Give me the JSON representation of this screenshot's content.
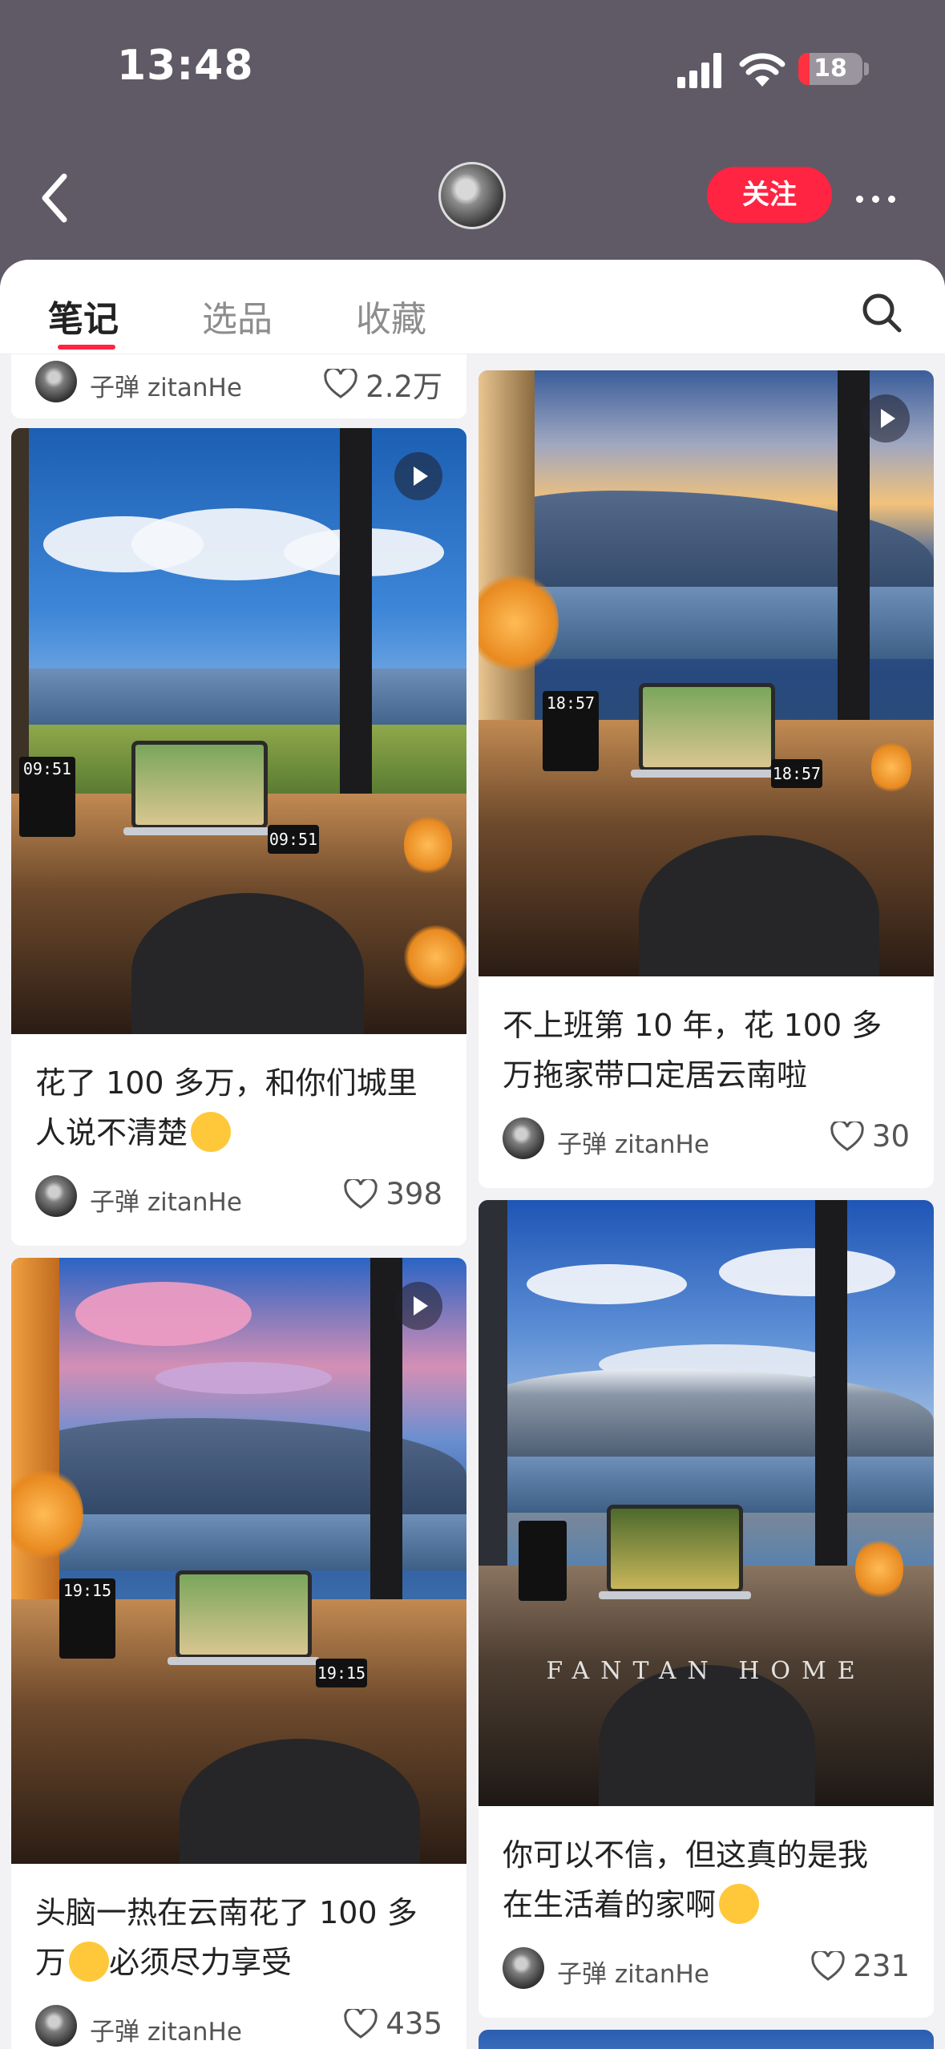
{
  "status_bar": {
    "time": "13:48",
    "battery": "18"
  },
  "header": {
    "follow_label": "关注"
  },
  "tabs": [
    {
      "label": "笔记",
      "active": true
    },
    {
      "label": "选品",
      "active": false
    },
    {
      "label": "收藏",
      "active": false
    }
  ],
  "feed": {
    "partial_top": {
      "author": "子弹 zitanHe",
      "likes": "2.2万"
    },
    "left": [
      {
        "title_line1": "花了 100 多万，和你们城里",
        "title_line2": "人说不清楚",
        "emoji": "🤣",
        "author": "子弹 zitanHe",
        "likes": "398",
        "clock": "09:51"
      },
      {
        "title_line1": "头脑一热在云南花了 100 多",
        "title_line2": "万",
        "title_tail": "必须尽力享受",
        "emoji": "😂",
        "author": "子弹 zitanHe",
        "likes": "435",
        "clock": "19:15"
      }
    ],
    "right": [
      {
        "title_line1": "不上班第 10 年，花 100 多",
        "title_line2": "万拖家带口定居云南啦",
        "author": "子弹 zitanHe",
        "likes": "30",
        "clock": "18:57"
      },
      {
        "title_line1": "你可以不信，但这真的是我",
        "title_line2": "在生活着的家啊",
        "emoji": "😭",
        "author": "子弹 zitanHe",
        "likes": "231",
        "watermark": "FANTAN HOME"
      }
    ]
  },
  "colors": {
    "accent": "#ff2442",
    "header_bg": "#5f5a66"
  },
  "icons": [
    "back-chevron-icon",
    "more-dots-icon",
    "search-icon",
    "heart-icon",
    "play-icon"
  ]
}
